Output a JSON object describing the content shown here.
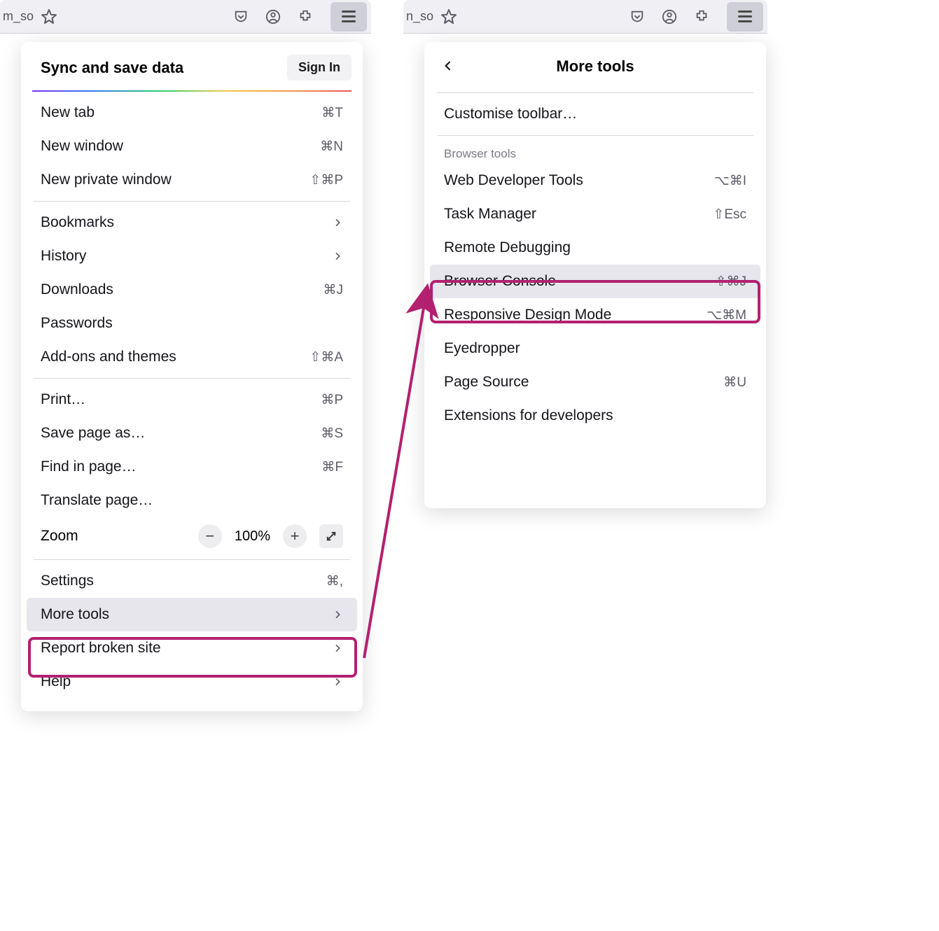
{
  "toolbar": {
    "url_fragment": "m_so",
    "url_fragment_right": "n_so"
  },
  "main_menu": {
    "sync_title": "Sync and save data",
    "signin_label": "Sign In",
    "items_a": [
      {
        "label": "New tab",
        "shortcut": "⌘T"
      },
      {
        "label": "New window",
        "shortcut": "⌘N"
      },
      {
        "label": "New private window",
        "shortcut": "⇧⌘P"
      }
    ],
    "items_b": [
      {
        "label": "Bookmarks",
        "chevron": true
      },
      {
        "label": "History",
        "chevron": true
      },
      {
        "label": "Downloads",
        "shortcut": "⌘J"
      },
      {
        "label": "Passwords"
      },
      {
        "label": "Add-ons and themes",
        "shortcut": "⇧⌘A"
      }
    ],
    "items_c": [
      {
        "label": "Print…",
        "shortcut": "⌘P"
      },
      {
        "label": "Save page as…",
        "shortcut": "⌘S"
      },
      {
        "label": "Find in page…",
        "shortcut": "⌘F"
      },
      {
        "label": "Translate page…"
      }
    ],
    "zoom_label": "Zoom",
    "zoom_level": "100%",
    "items_d": [
      {
        "label": "Settings",
        "shortcut": "⌘,"
      },
      {
        "label": "More tools",
        "chevron": true,
        "highlight": true
      },
      {
        "label": "Report broken site",
        "chevron": true
      },
      {
        "label": "Help",
        "chevron": true
      }
    ]
  },
  "submenu": {
    "title": "More tools",
    "customise": "Customise toolbar…",
    "section_label": "Browser tools",
    "items": [
      {
        "label": "Web Developer Tools",
        "shortcut": "⌥⌘I"
      },
      {
        "label": "Task Manager",
        "shortcut": "⇧Esc"
      },
      {
        "label": "Remote Debugging"
      },
      {
        "label": "Browser Console",
        "shortcut": "⇧⌘J",
        "highlight": true
      },
      {
        "label": "Responsive Design Mode",
        "shortcut": "⌥⌘M"
      },
      {
        "label": "Eyedropper"
      },
      {
        "label": "Page Source",
        "shortcut": "⌘U"
      },
      {
        "label": "Extensions for developers"
      }
    ]
  }
}
